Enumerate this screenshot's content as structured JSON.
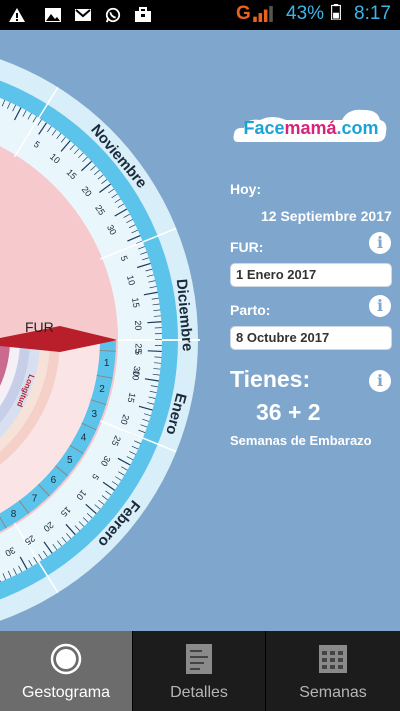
{
  "status_bar": {
    "network_label": "G",
    "battery_percent": "43%",
    "time": "8:17",
    "icons": [
      "warning-icon",
      "image-icon",
      "gmail-icon",
      "whatsapp-icon",
      "briefcase-icon"
    ]
  },
  "wheel": {
    "fur_label": "FUR",
    "months": [
      "Noviembre",
      "Diciembre",
      "Enero",
      "Febrero"
    ],
    "month_day_labels": [
      "5",
      "10",
      "15",
      "20",
      "25",
      "30"
    ],
    "week_numbers": [
      "1",
      "2",
      "3",
      "4",
      "5",
      "6",
      "7",
      "8"
    ],
    "inner_ring_label": "Longitud"
  },
  "brand": {
    "part1": "Face",
    "part2": "mamá",
    "part3": ".com"
  },
  "info": {
    "hoy_label": "Hoy:",
    "hoy_value": "12 Septiembre 2017",
    "fur_label": "FUR:",
    "fur_value": "1 Enero 2017",
    "parto_label": "Parto:",
    "parto_value": "8 Octubre 2017",
    "tienes_label": "Tienes:",
    "weeks_value": "36 + 2",
    "semanas_label": "Semanas de Embarazo"
  },
  "bottom_nav": {
    "tabs": [
      {
        "label": "Gestograma",
        "active": true
      },
      {
        "label": "Detalles",
        "active": false
      },
      {
        "label": "Semanas",
        "active": false
      }
    ]
  },
  "colors": {
    "background": "#7fa6cc",
    "outer_ring": "#d8eef8",
    "month_ring": "#5cc4ea",
    "pink_center": "#f6c9cc",
    "fur_arrow": "#b81f2a",
    "brand_blue": "#1aa3d9",
    "brand_pink": "#d8237a"
  }
}
